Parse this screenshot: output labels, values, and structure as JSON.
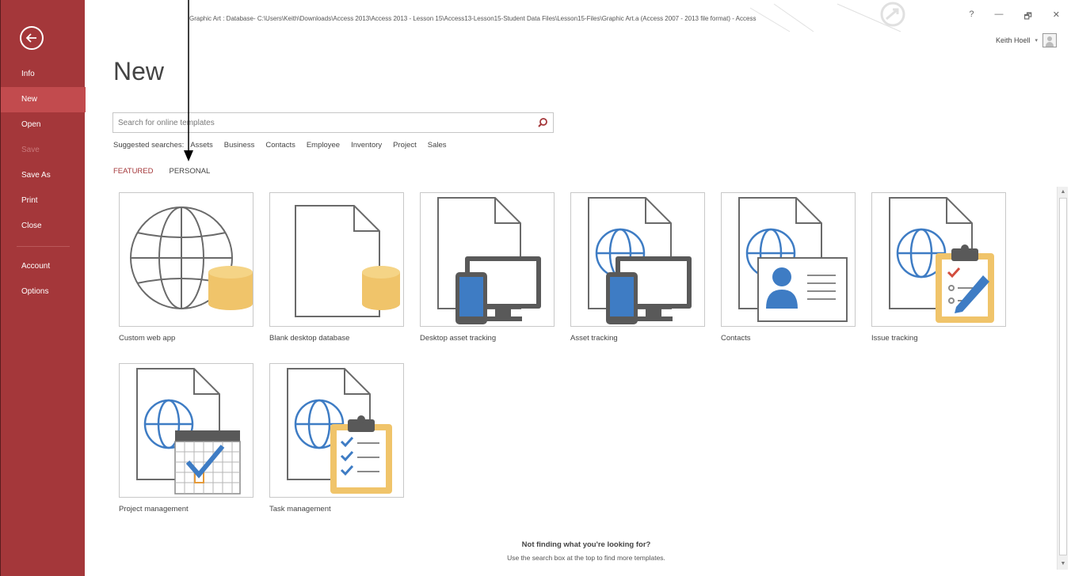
{
  "window": {
    "title": "Graphic Art : Database- C:\\Users\\Keith\\Downloads\\Access 2013\\Access 2013 - Lesson 15\\Access13-Lesson15-Student Data Files\\Lesson15-Files\\Graphic Art.a (Access 2007 - 2013 file format) - Access",
    "help": "?",
    "minimize": "—",
    "restore": "🗗",
    "close": "✕",
    "user_name": "Keith Hoell",
    "user_caret": "▾"
  },
  "sidebar": {
    "back_icon": "back-arrow-icon",
    "items": [
      {
        "label": "Info"
      },
      {
        "label": "New"
      },
      {
        "label": "Open"
      },
      {
        "label": "Save"
      },
      {
        "label": "Save As"
      },
      {
        "label": "Print"
      },
      {
        "label": "Close"
      },
      {
        "label": "Account"
      },
      {
        "label": "Options"
      }
    ]
  },
  "main": {
    "title": "New",
    "search_placeholder": "Search for online templates",
    "suggested_label": "Suggested searches:",
    "suggested": [
      "Assets",
      "Business",
      "Contacts",
      "Employee",
      "Inventory",
      "Project",
      "Sales"
    ],
    "tabs": [
      "FEATURED",
      "PERSONAL"
    ],
    "templates": [
      {
        "label": "Custom web app",
        "icon": "globe-database-icon"
      },
      {
        "label": "Blank desktop database",
        "icon": "blank-document-database-icon"
      },
      {
        "label": "Desktop asset tracking",
        "icon": "desktop-devices-icon"
      },
      {
        "label": "Asset tracking",
        "icon": "globe-devices-icon"
      },
      {
        "label": "Contacts",
        "icon": "contact-card-icon"
      },
      {
        "label": "Issue tracking",
        "icon": "clipboard-pencil-icon"
      },
      {
        "label": "Project management",
        "icon": "calendar-check-icon"
      },
      {
        "label": "Task management",
        "icon": "clipboard-checklist-icon"
      }
    ],
    "footer_heading": "Not finding what you're looking for?",
    "footer_sub": "Use the search box at the top to find more templates."
  },
  "colors": {
    "accent": "#a4373a",
    "db_yellow": "#f0c46a",
    "device_gray": "#595959",
    "globe_blue": "#3e7cc4"
  }
}
